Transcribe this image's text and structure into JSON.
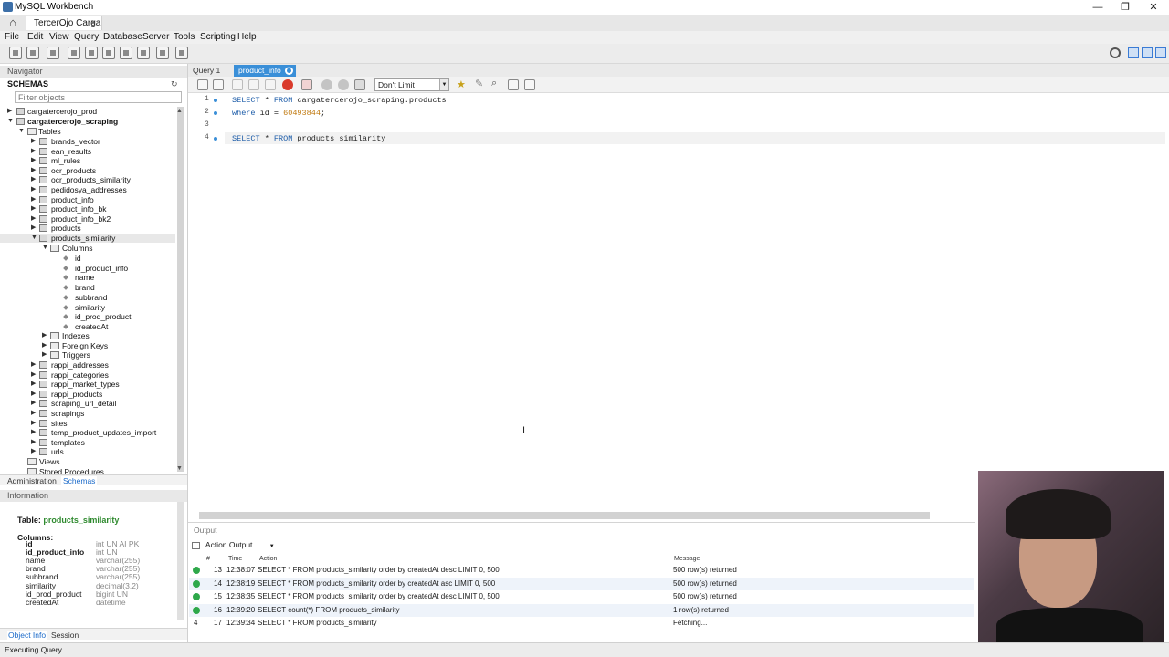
{
  "window": {
    "title": "MySQL Workbench",
    "connection_tab": "TercerOjo Carga",
    "close_glyph": "×",
    "minimize_glyph": "—",
    "maximize_glyph": "❐",
    "window_close_glyph": "✕"
  },
  "menu": [
    "File",
    "Edit",
    "View",
    "Query",
    "Database",
    "Server",
    "Tools",
    "Scripting",
    "Help"
  ],
  "navigator": {
    "header": "Navigator",
    "schemas_title": "SCHEMAS",
    "filter_placeholder": "Filter objects",
    "schemas": [
      "cargatercerojo_prod",
      "cargatercerojo_scraping"
    ],
    "tables_label": "Tables",
    "tables_before": [
      "brands_vector",
      "ean_results",
      "ml_rules",
      "ocr_products",
      "ocr_products_similarity",
      "pedidosya_addresses",
      "product_info",
      "product_info_bk",
      "product_info_bk2",
      "products"
    ],
    "selected_table": "products_similarity",
    "columns_label": "Columns",
    "columns": [
      "id",
      "id_product_info",
      "name",
      "brand",
      "subbrand",
      "similarity",
      "id_prod_product",
      "createdAt"
    ],
    "sub_folders": [
      "Indexes",
      "Foreign Keys",
      "Triggers"
    ],
    "tables_after": [
      "rappi_addresses",
      "rappi_categories",
      "rappi_market_types",
      "rappi_products",
      "scraping_url_detail",
      "scrapings",
      "sites",
      "temp_product_updates_import",
      "templates",
      "urls"
    ],
    "views_label": "Views",
    "stored_procedures_label": "Stored Procedures",
    "bottom_tabs": [
      "Administration",
      "Schemas"
    ]
  },
  "information": {
    "header": "Information",
    "table_label": "Table:",
    "table_name": "products_similarity",
    "columns_label": "Columns:",
    "columns": [
      {
        "name": "id",
        "type": "int UN AI PK",
        "bold": true
      },
      {
        "name": "id_product_info",
        "type": "int UN",
        "bold": true
      },
      {
        "name": "name",
        "type": "varchar(255)",
        "bold": false
      },
      {
        "name": "brand",
        "type": "varchar(255)",
        "bold": false
      },
      {
        "name": "subbrand",
        "type": "varchar(255)",
        "bold": false
      },
      {
        "name": "similarity",
        "type": "decimal(3,2)",
        "bold": false
      },
      {
        "name": "id_prod_product",
        "type": "bigint UN",
        "bold": false
      },
      {
        "name": "createdAt",
        "type": "datetime",
        "bold": false
      }
    ],
    "bottom_tabs": [
      "Object Info",
      "Session"
    ]
  },
  "editor": {
    "tabs": [
      "Query 1",
      "product_info"
    ],
    "limit_value": "Don't Limit",
    "lines": [
      {
        "num": "1",
        "parts": [
          {
            "t": "SELECT",
            "c": "kw"
          },
          {
            "t": " * ",
            "c": ""
          },
          {
            "t": "FROM",
            "c": "kw"
          },
          {
            "t": " cargatercerojo_scraping.products",
            "c": ""
          }
        ]
      },
      {
        "num": "2",
        "parts": [
          {
            "t": "where",
            "c": "kw"
          },
          {
            "t": " id = ",
            "c": ""
          },
          {
            "t": "60493844",
            "c": "num"
          },
          {
            "t": ";",
            "c": ""
          }
        ]
      },
      {
        "num": "3",
        "parts": []
      },
      {
        "num": "4",
        "parts": [
          {
            "t": "SELECT",
            "c": "kw"
          },
          {
            "t": " * ",
            "c": ""
          },
          {
            "t": "FROM",
            "c": "kw"
          },
          {
            "t": " products_similarity",
            "c": ""
          }
        ]
      }
    ]
  },
  "output": {
    "header": "Output",
    "selector": "Action Output",
    "columns": [
      "#",
      "Time",
      "Action",
      "Message"
    ],
    "rows": [
      {
        "icon": "ok",
        "num": "13",
        "time": "12:38:07",
        "action": "SELECT * FROM products_similarity order by createdAt desc LIMIT 0, 500",
        "message": "500 row(s) returned"
      },
      {
        "icon": "ok",
        "num": "14",
        "time": "12:38:19",
        "action": "SELECT * FROM products_similarity order by createdAt asc LIMIT 0, 500",
        "message": "500 row(s) returned"
      },
      {
        "icon": "ok",
        "num": "15",
        "time": "12:38:35",
        "action": "SELECT * FROM products_similarity order by createdAt desc LIMIT 0, 500",
        "message": "500 row(s) returned"
      },
      {
        "icon": "ok",
        "num": "16",
        "time": "12:39:20",
        "action": "SELECT count(*) FROM products_similarity",
        "message": "1 row(s) returned"
      },
      {
        "icon": "running",
        "num": "17",
        "time": "12:39:34",
        "action": "SELECT * FROM products_similarity",
        "message": "Fetching..."
      }
    ]
  },
  "status": "Executing Query..."
}
